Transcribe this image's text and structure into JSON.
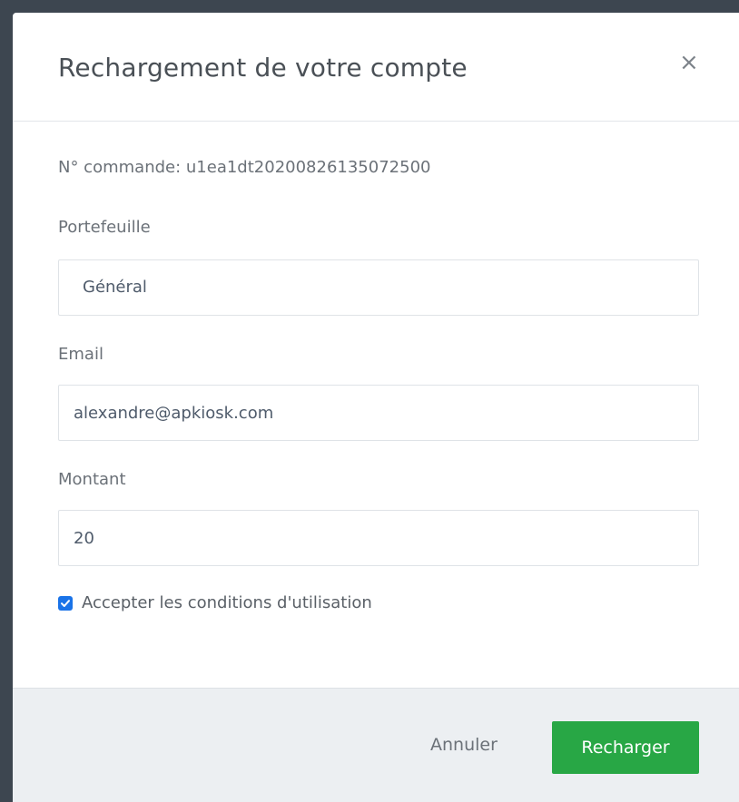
{
  "modal": {
    "title": "Rechargement de votre compte",
    "close_glyph": "×",
    "order_line": "N° commande: u1ea1dt20200826135072500",
    "portfolio": {
      "label": "Portefeuille",
      "selected": "Général"
    },
    "email": {
      "label": "Email",
      "value": "alexandre@apkiosk.com"
    },
    "amount": {
      "label": "Montant",
      "value": "20"
    },
    "terms": {
      "label": "Accepter les conditions d'utilisation",
      "checked": true
    },
    "footer": {
      "cancel_label": "Annuler",
      "submit_label": "Recharger"
    }
  },
  "colors": {
    "accent_green": "#28a745",
    "checkbox_blue": "#1a73e8",
    "footer_bg": "#eceff2"
  },
  "icons": {
    "close": "close-icon",
    "check": "checkmark-icon"
  }
}
